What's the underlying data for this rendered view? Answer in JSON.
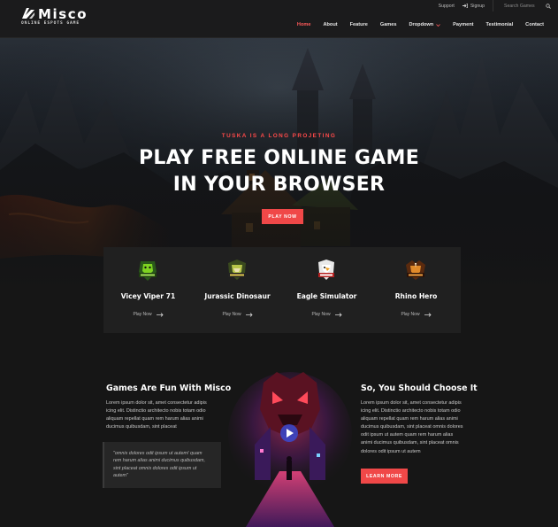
{
  "brand": {
    "name": "Misco",
    "tagline": "ONLINE ESPOTS GAME"
  },
  "topbar": {
    "support": "Support",
    "signup": "Signup",
    "search_placeholder": "Search Games"
  },
  "nav": {
    "items": [
      {
        "label": "Home",
        "active": true
      },
      {
        "label": "About"
      },
      {
        "label": "Feature"
      },
      {
        "label": "Games"
      },
      {
        "label": "Dropdown",
        "has_caret": true
      },
      {
        "label": "Payment"
      },
      {
        "label": "Testimonial"
      },
      {
        "label": "Contact"
      }
    ]
  },
  "hero": {
    "eyebrow": "TUSKA IS A LONG PROJETING",
    "headline_line1": "PLAY FREE ONLINE GAME",
    "headline_line2": "IN YOUR BROWSER",
    "cta": "PLAY NOW"
  },
  "games": [
    {
      "title": "Vicey Viper 71",
      "link": "Play Now",
      "emblem": "viper-emblem-icon"
    },
    {
      "title": "Jurassic Dinosaur",
      "link": "Play Now",
      "emblem": "dinosaur-emblem-icon"
    },
    {
      "title": "Eagle Simulator",
      "link": "Play Now",
      "emblem": "eagle-emblem-icon"
    },
    {
      "title": "Rhino Hero",
      "link": "Play Now",
      "emblem": "rhino-emblem-icon"
    }
  ],
  "about": {
    "left_title": "Games Are Fun With Misco",
    "left_text": [
      "Lorem ipsum dolor sit, amet consectetur adipis",
      "icing elit. Distinctio architecto nobis totam odio",
      "aliquam repellat quam rem harum alias animi",
      "ducimus quibusdam, sint placeat"
    ],
    "quote": [
      "\"omnis dolores odit ipsum ut autem! quam",
      "rem harum alias animi ducimus quibusdam,",
      "sint placeat omnis dolores odit ipsum ut",
      "autem\""
    ],
    "right_title": "So, You Should Choose It",
    "right_text": [
      "Lorem ipsum dolor sit, amet consectetur adipis",
      "icing elit. Distinctio architecto nobis totam odio",
      "aliquam repellat quam rem harum alias animi",
      "ducimus quibusdam, sint placeat omnis dolores",
      "odit ipsum ut autem quam rem harum alias",
      "animi ducimus quibusdam, sint placeat omnis",
      "dolores odit ipsum ut autem"
    ],
    "cta": "LEARN MORE"
  },
  "colors": {
    "accent": "#f04848",
    "background": "#161616",
    "card_bg": "#202020",
    "header_bg": "#1b1b1c"
  }
}
